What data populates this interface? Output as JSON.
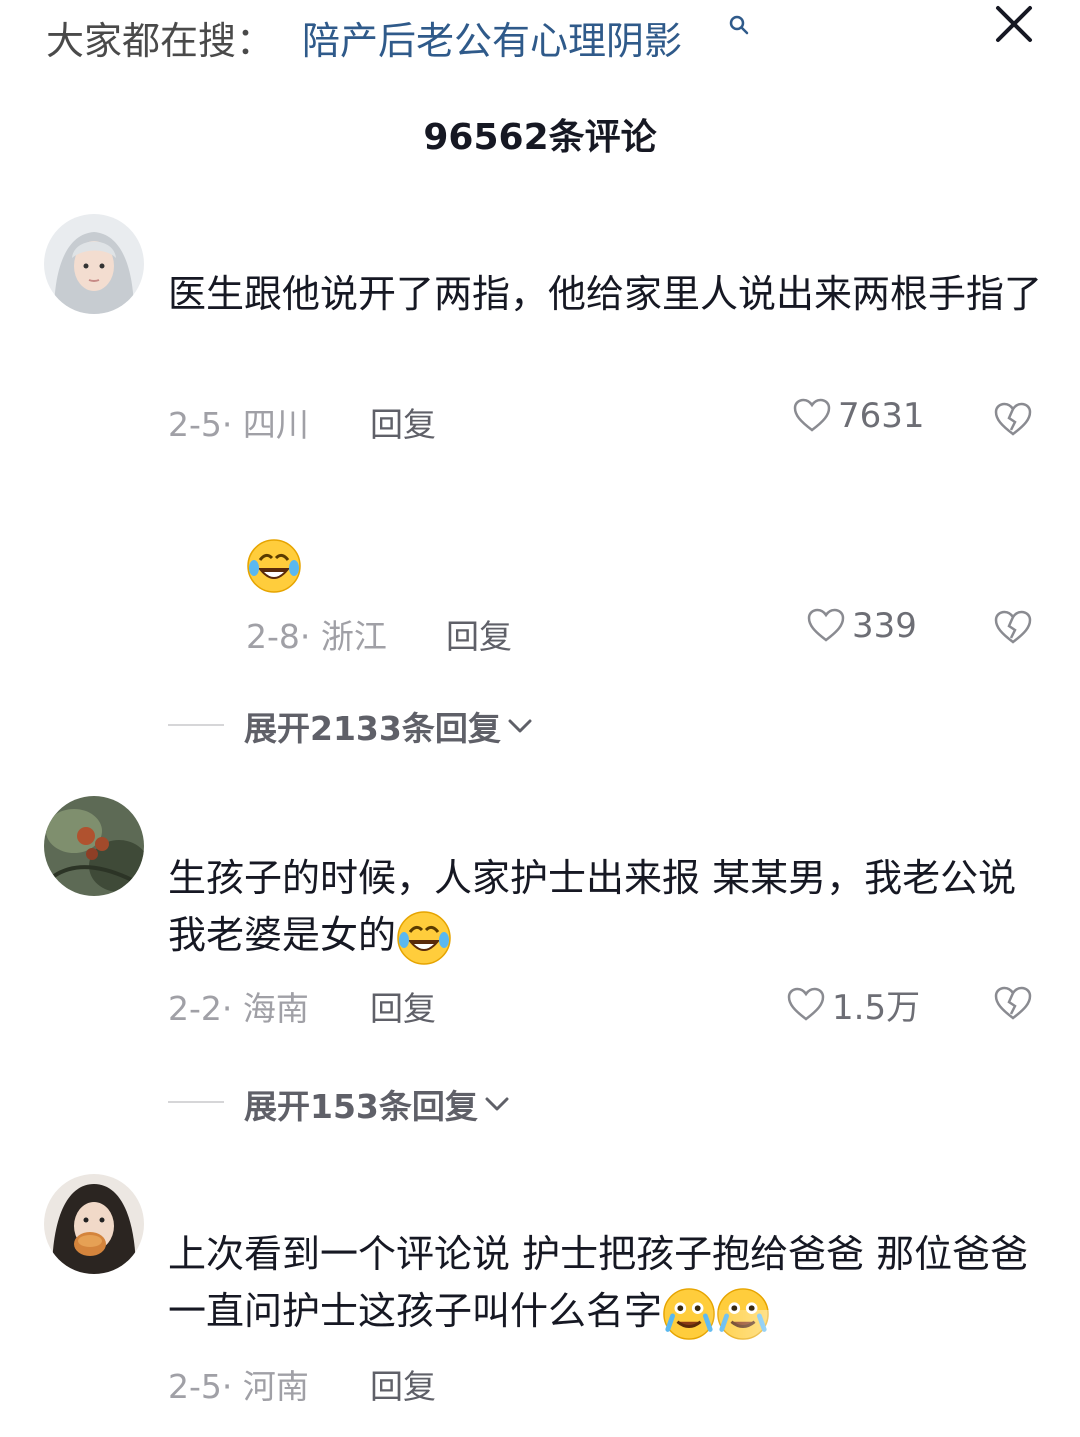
{
  "search_bar": {
    "prefix": "大家都在搜：",
    "query": "陪产后老公有心理阴影",
    "accent_color": "#2f5a8a",
    "search_icon": "search-icon",
    "close_icon": "close-icon"
  },
  "header": {
    "comment_count_label": "96562条评论"
  },
  "comments": [
    {
      "text": "医生跟他说开了两指，他给家里人说出来两根手指了",
      "date": "2-5",
      "location": "四川",
      "reply_label": "回复",
      "likes": "7631",
      "sub_reply": {
        "emoji": "laughing-crying-emoji",
        "date": "2-8",
        "location": "浙江",
        "reply_label": "回复",
        "likes": "339"
      },
      "expand_label": "展开2133条回复"
    },
    {
      "text": "生孩子的时候，人家护士出来报 某某男，我老公说我老婆是女的",
      "date": "2-2",
      "location": "海南",
      "reply_label": "回复",
      "likes": "1.5万",
      "expand_label": "展开153条回复"
    },
    {
      "text": "上次看到一个评论说 护士把孩子抱给爸爸 那位爸爸一直问护士这孩子叫什么名字",
      "date": "2-5",
      "location": "河南",
      "reply_label": "回复"
    }
  ],
  "icons": {
    "like": "heart-icon",
    "dislike": "broken-heart-icon",
    "expand": "chevron-down-icon"
  }
}
